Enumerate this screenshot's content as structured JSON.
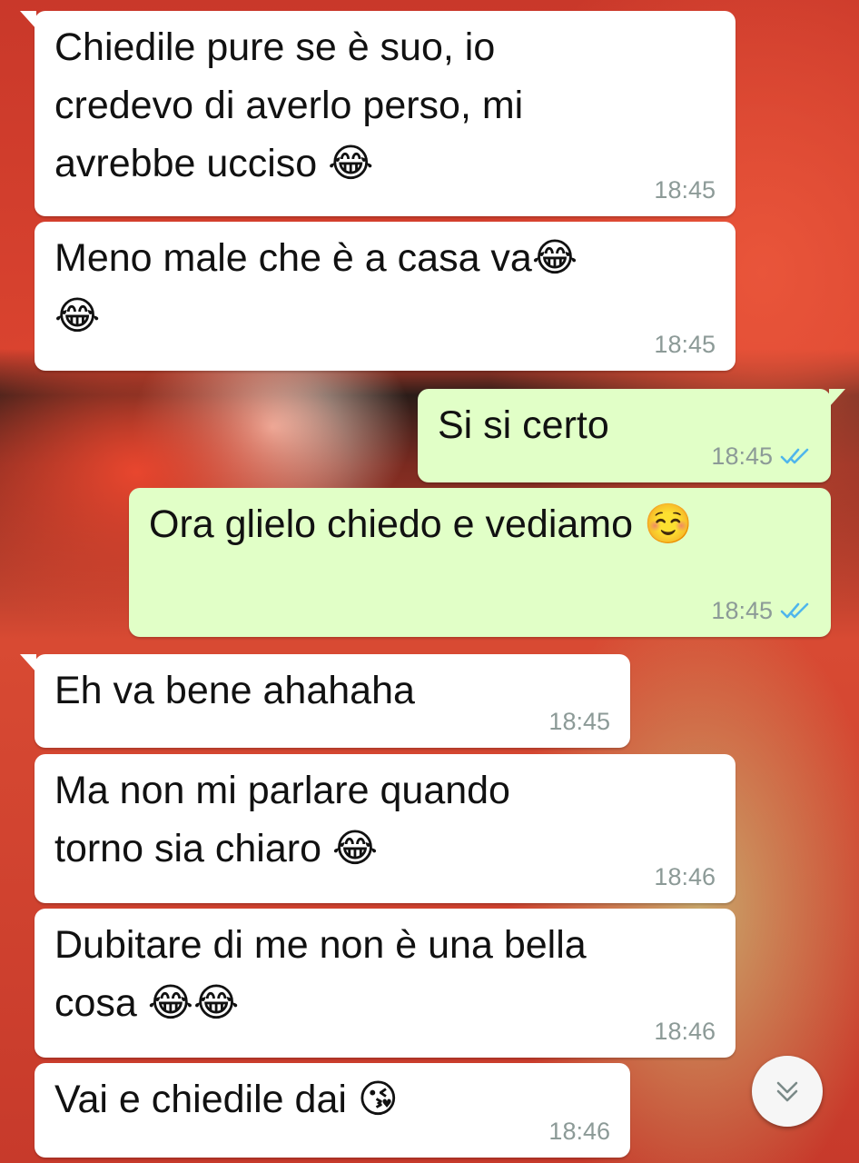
{
  "messages": [
    {
      "direction": "in",
      "text": "Chiedile pure se è suo, io\ncredevo di averlo perso, mi\navrebbe ucciso 😂",
      "time": "18:45"
    },
    {
      "direction": "in",
      "text": "Meno male che è a casa va😂\n😂",
      "time": "18:45"
    },
    {
      "direction": "out",
      "text": "Si si certo",
      "time": "18:45",
      "status": "read"
    },
    {
      "direction": "out",
      "text": "Ora glielo chiedo e vediamo ☺️",
      "time": "18:45",
      "status": "read"
    },
    {
      "direction": "in",
      "text": "Eh va bene ahahaha",
      "time": "18:45"
    },
    {
      "direction": "in",
      "text": "Ma non mi parlare quando\ntorno sia chiaro 😂",
      "time": "18:46"
    },
    {
      "direction": "in",
      "text": "Dubitare di me non è una bella\ncosa 😂😂",
      "time": "18:46"
    },
    {
      "direction": "in",
      "text": "Vai e chiedile dai 😘",
      "time": "18:46"
    }
  ],
  "colors": {
    "incoming_bubble": "#ffffff",
    "outgoing_bubble": "#e1ffc7",
    "timestamp": "#8c9a97",
    "read_ticks": "#4fb6ec"
  },
  "icons": {
    "read_receipt": "double-check-icon",
    "scroll_down": "chevron-double-down-icon"
  }
}
